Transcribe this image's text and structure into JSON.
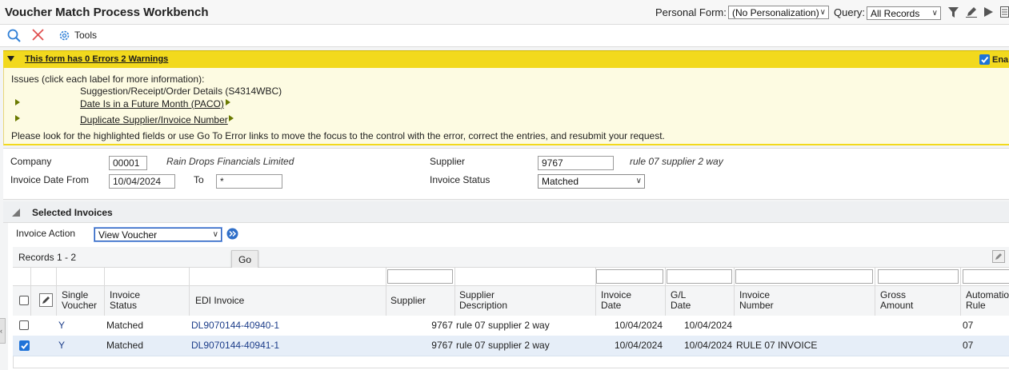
{
  "header": {
    "title": "Voucher Match Process Workbench",
    "personal_form_label": "Personal Form:",
    "personal_form_value": "(No Personalization)",
    "query_label": "Query:",
    "query_value": "All Records"
  },
  "toolbar": {
    "tools_label": "Tools"
  },
  "errors": {
    "summary": "This form has 0 Errors 2 Warnings",
    "enable_label": "Ena",
    "issues_intro": "Issues (click each label for more information):",
    "group_title": "Suggestion/Receipt/Order Details (S4314WBC)",
    "warnings": [
      "Date Is in a Future Month (PACO)",
      "Duplicate Supplier/Invoice Number"
    ],
    "instructions": "Please look for the highlighted fields or use Go To Error links to move the focus to the control with the error, correct the entries, and resubmit your request."
  },
  "form": {
    "company_label": "Company",
    "company_value": "00001",
    "company_name": "Rain Drops Financials Limited",
    "supplier_label": "Supplier",
    "supplier_value": "9767",
    "supplier_name": "rule 07 supplier 2 way",
    "date_from_label": "Invoice Date From",
    "date_from_value": "10/04/2024",
    "to_label": "To",
    "to_value": "*",
    "status_label": "Invoice Status",
    "status_value": "Matched"
  },
  "selected": {
    "section_title": "Selected Invoices",
    "action_label": "Invoice Action",
    "action_value": "View Voucher",
    "go_tooltip": "Go",
    "records": "Records 1 - 2"
  },
  "grid": {
    "columns": [
      "Single Voucher",
      "Invoice Status",
      "EDI Invoice",
      "Supplier",
      "Supplier Description",
      "Invoice Date",
      "G/L Date",
      "Invoice Number",
      "Gross Amount",
      "Automation Rule"
    ],
    "rows": [
      {
        "checked": false,
        "single": "Y",
        "status": "Matched",
        "edi": "DL9070144-40940-1",
        "supplier": "9767",
        "desc": "rule 07 supplier 2 way",
        "inv_date": "10/04/2024",
        "gl_date": "10/04/2024",
        "inv_num": "",
        "gross": "",
        "rule": "07"
      },
      {
        "checked": true,
        "single": "Y",
        "status": "Matched",
        "edi": "DL9070144-40941-1",
        "supplier": "9767",
        "desc": "rule 07 supplier 2 way",
        "inv_date": "10/04/2024",
        "gl_date": "10/04/2024",
        "inv_num": "RULE 07 INVOICE",
        "gross": "",
        "rule": "07"
      }
    ]
  }
}
